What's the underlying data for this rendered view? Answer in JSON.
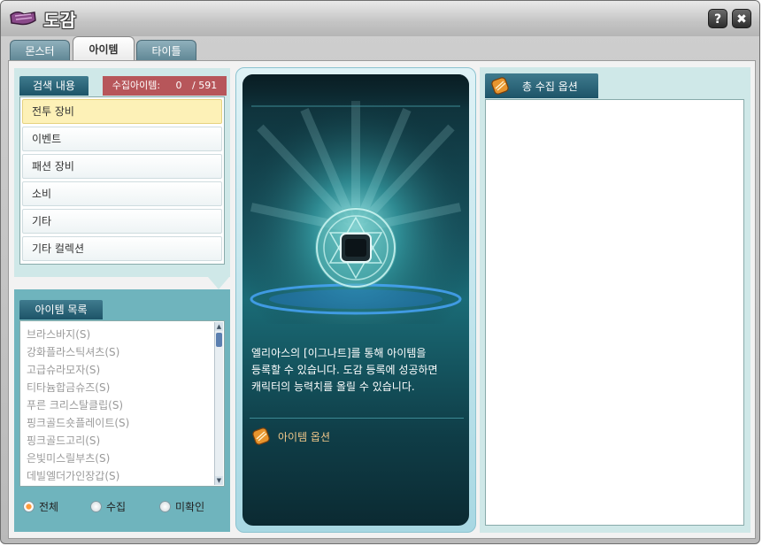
{
  "window": {
    "title": "도감"
  },
  "title_buttons": {
    "help": "?",
    "close": "✖"
  },
  "tabs": [
    {
      "label": "몬스터"
    },
    {
      "label": "아이템",
      "active": true
    },
    {
      "label": "타이틀"
    }
  ],
  "search": {
    "tab_label": "검색 내용",
    "collected_label": "수집아이템:",
    "collected_count": "0",
    "total_count": "/ 591",
    "categories": [
      "전투 장비",
      "이벤트",
      "패션 장비",
      "소비",
      "기타",
      "기타 컬렉션"
    ],
    "selected_index": 0
  },
  "item_list": {
    "tab_label": "아이템 목록",
    "items": [
      "브라스바지(S)",
      "강화플라스틱셔츠(S)",
      "고급슈라모자(S)",
      "티타늄합금슈즈(S)",
      "푸른 크리스탈클립(S)",
      "핑크골드숏플레이트(S)",
      "핑크골드고리(S)",
      "은빛미스릴부츠(S)",
      "데빌엘더가인장갑(S)"
    ],
    "filters": [
      {
        "label": "전체",
        "checked": true
      },
      {
        "label": "수집",
        "checked": false
      },
      {
        "label": "미확인",
        "checked": false
      }
    ]
  },
  "card": {
    "description": [
      "엘리아스의 [이그나트]를 통해 아이템을",
      "등록할 수 있습니다. 도감 등록에 성공하면",
      "캐릭터의 능력치를 올릴 수 있습니다."
    ],
    "option_label": "아이템 옵션",
    "option_icon": "scroll-icon"
  },
  "total_options": {
    "tab_label": "총 수집 옵션",
    "icon": "scroll-icon"
  },
  "colors": {
    "accent_teal": "#1d5468",
    "count_red": "#b7565a",
    "selected_yellow": "#fdf1b7",
    "option_gold": "#f2c88a"
  }
}
